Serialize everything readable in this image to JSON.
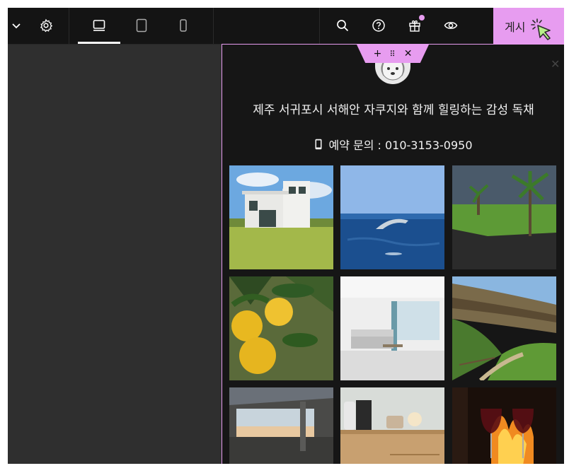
{
  "toolbar": {
    "icons": [
      "chevron-down-icon",
      "gear-icon",
      "desktop-icon",
      "tablet-icon",
      "mobile-icon",
      "search-icon",
      "help-icon",
      "gift-icon",
      "eye-icon"
    ],
    "publish_label": "게시",
    "gift_dot_color": "#e79cf0",
    "accent_color": "#e79cf0"
  },
  "panel": {
    "headline": "제주 서귀포시 서해안 자쿠지와 함께 힐링하는 감성 독채",
    "contact": "예약 문의 : 010-3153-0950",
    "tab_icons": [
      "plus-icon",
      "drag-handle-icon",
      "close-icon"
    ],
    "gallery": [
      {
        "name": "house-photo"
      },
      {
        "name": "dolphin-photo"
      },
      {
        "name": "palm-coast-photo"
      },
      {
        "name": "tangerine-photo"
      },
      {
        "name": "living-room-photo"
      },
      {
        "name": "cliff-trail-photo"
      },
      {
        "name": "terrace-photo"
      },
      {
        "name": "interior-desk-photo"
      },
      {
        "name": "wine-fire-photo"
      }
    ]
  }
}
